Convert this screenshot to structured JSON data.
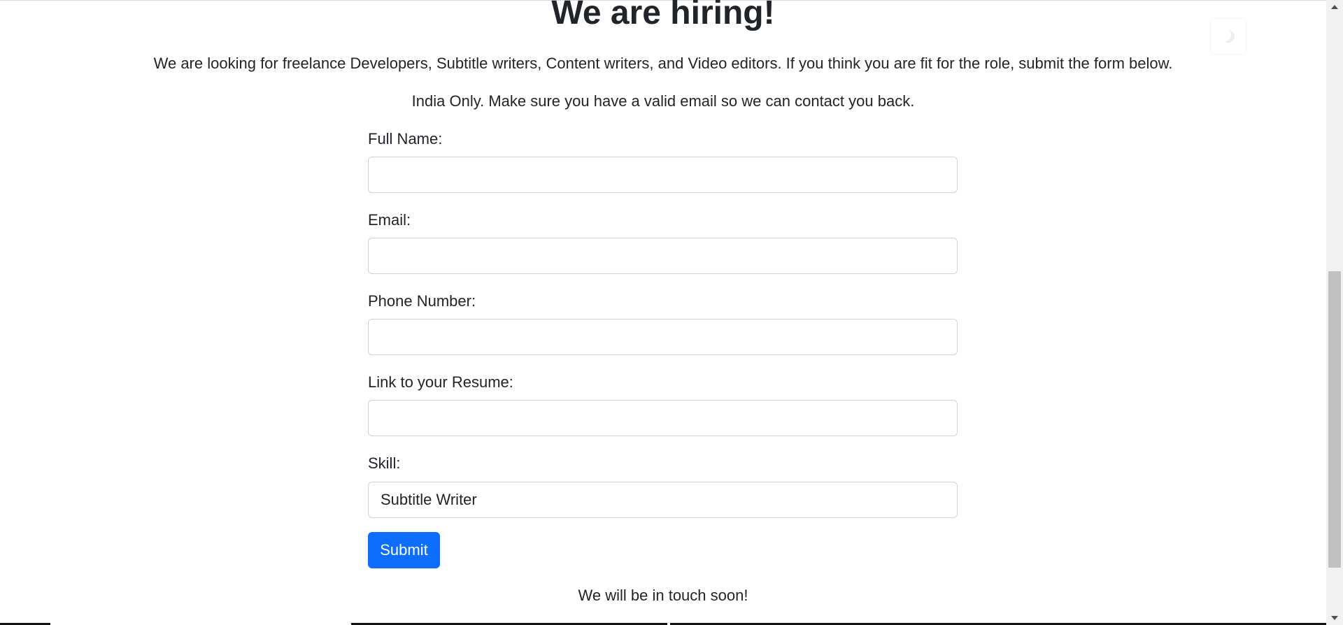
{
  "page": {
    "heading": "We are hiring!",
    "intro": "We are looking for freelance Developers, Subtitle writers, Content writers, and Video editors. If you think you are fit for the role, submit the form below.",
    "note": "India Only. Make sure you have a valid email so we can contact you back.",
    "footer": "We will be in touch soon!"
  },
  "form": {
    "full_name": {
      "label": "Full Name:",
      "value": ""
    },
    "email": {
      "label": "Email:",
      "value": ""
    },
    "phone": {
      "label": "Phone Number:",
      "value": ""
    },
    "resume": {
      "label": "Link to your Resume:",
      "value": ""
    },
    "skill": {
      "label": "Skill:",
      "selected": "Subtitle Writer"
    },
    "submit_label": "Submit"
  },
  "theme_toggle": {
    "icon": "moon-icon"
  },
  "colors": {
    "primary": "#0d6efd",
    "text": "#212529",
    "border": "#ced4da"
  }
}
